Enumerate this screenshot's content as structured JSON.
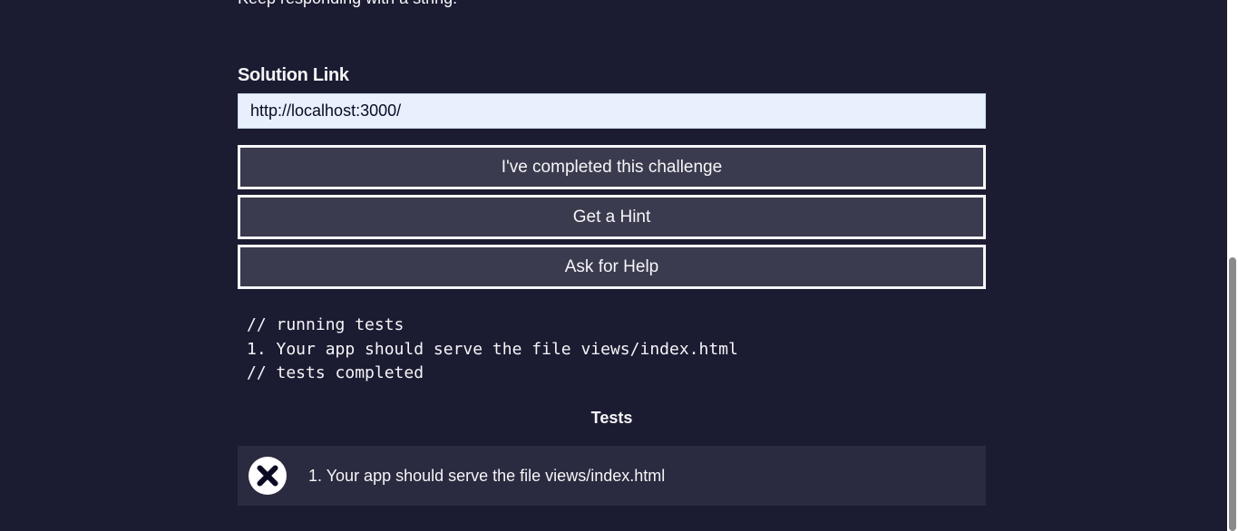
{
  "intro": {
    "text": "Keep responding with a string."
  },
  "solution": {
    "label": "Solution Link",
    "value": "http://localhost:3000/"
  },
  "buttons": {
    "complete": "I've completed this challenge",
    "hint": "Get a Hint",
    "help": "Ask for Help"
  },
  "console": {
    "lines": [
      "// running tests",
      "1. Your app should serve the file views/index.html",
      "// tests completed"
    ]
  },
  "tests": {
    "heading": "Tests",
    "items": [
      {
        "text": "1. Your app should serve the file views/index.html",
        "status": "failed",
        "icon": "fail-icon"
      }
    ]
  },
  "colors": {
    "background": "#1b1b32",
    "button_bg": "#3b3b4f",
    "test_row_bg": "#2a2a40",
    "input_bg": "#e8f0fe"
  }
}
